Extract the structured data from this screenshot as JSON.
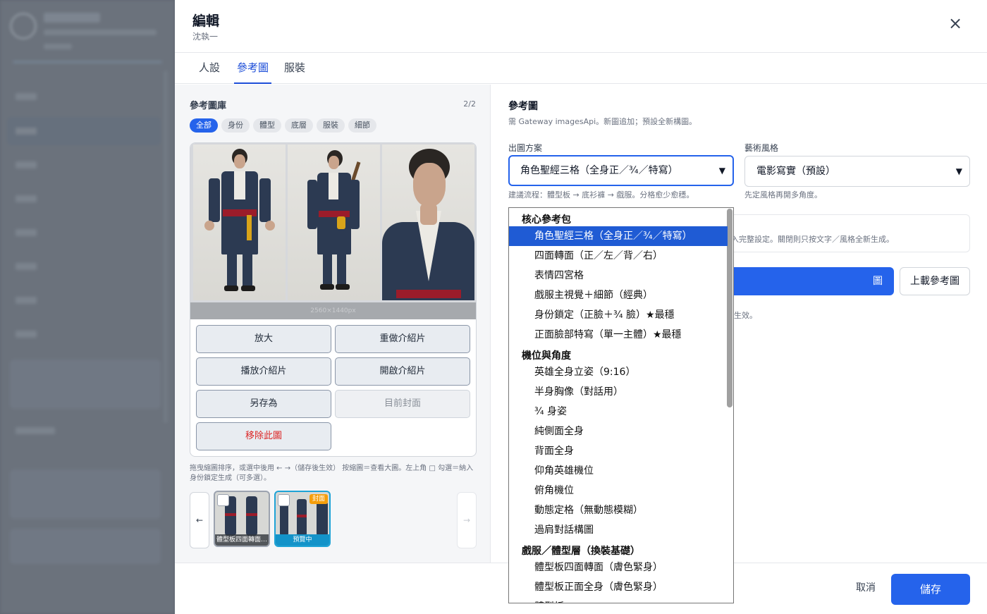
{
  "modal": {
    "title": "編輯",
    "subtitle": "沈執一",
    "close_icon": "×"
  },
  "tabs": [
    {
      "label": "人設",
      "active": false
    },
    {
      "label": "參考圖",
      "active": true
    },
    {
      "label": "服裝",
      "active": false
    }
  ],
  "gallery": {
    "title": "參考圖庫",
    "count": "2/2",
    "chips": [
      "全部",
      "身份",
      "體型",
      "底層",
      "服裝",
      "細節"
    ],
    "active_chip": "全部",
    "resolution": "2560×1440px",
    "actions": {
      "zoom": "放大",
      "redo_intro": "重做介紹片",
      "play_intro": "播放介紹片",
      "open_intro": "開啟介紹片",
      "save_as": "另存為",
      "current_cover": "目前封面",
      "remove": "移除此圖"
    },
    "hint": "拖曳縮圖排序，或選中後用 ← →（儲存後生效） 按縮圖＝查看大圖。左上角 □ 勾選＝納入身份鎖定生成（可多選）。",
    "prev_arrow": "←",
    "next_arrow": "→",
    "thumbnails": [
      {
        "caption": "體型板四面轉面…",
        "selected": false,
        "badge": ""
      },
      {
        "caption": "預覽中",
        "selected": true,
        "badge": "封面"
      }
    ]
  },
  "reference": {
    "title": "參考圖",
    "description": "需 Gateway imagesApi。新圖追加；預設全新構圖。",
    "scheme_label": "出圖方案",
    "scheme_value": "角色聖經三格（全身正／¾／特寫）",
    "scheme_hint": "建議流程：體型板 → 底衫褲 → 戲服。分格愈少愈穩。",
    "style_label": "藝術風格",
    "style_value": "電影寫實（預設）",
    "style_hint": "先定風格再開多角度。",
    "toggle_text": "會帶入完整設定。關閉則只按文字／風格全新生成。",
    "generate_label": "圖",
    "upload_label": "上載參考圖",
    "generate_note": "生效。"
  },
  "dropdown": {
    "groups": [
      {
        "label": "核心參考包",
        "options": [
          "角色聖經三格（全身正／¾／特寫）",
          "四面轉面（正／左／背／右）",
          "表情四宮格",
          "戲服主視覺＋細節（經典）",
          "身份鎖定（正臉＋¾ 臉）★最穩",
          "正面臉部特寫（單一主體）★最穩"
        ]
      },
      {
        "label": "機位與角度",
        "options": [
          "英雄全身立姿（9:16）",
          "半身胸像（對話用）",
          "¾ 身姿",
          "純側面全身",
          "背面全身",
          "仰角英雄機位",
          "俯角機位",
          "動態定格（無動態模糊）",
          "過肩對話構圖"
        ]
      },
      {
        "label": "戲服／體型層（換裝基礎）",
        "options": [
          "體型板四面轉面（膚色緊身）",
          "體型板正面全身（膚色緊身）",
          "體型板…"
        ]
      }
    ],
    "selected": "角色聖經三格（全身正／¾／特寫）"
  },
  "footer": {
    "cancel": "取消",
    "save": "儲存"
  },
  "colors": {
    "accent": "#2563eb",
    "danger": "#dc2626",
    "cover_badge": "#f59e0b",
    "selected_thumb": "#1fa3d6"
  }
}
